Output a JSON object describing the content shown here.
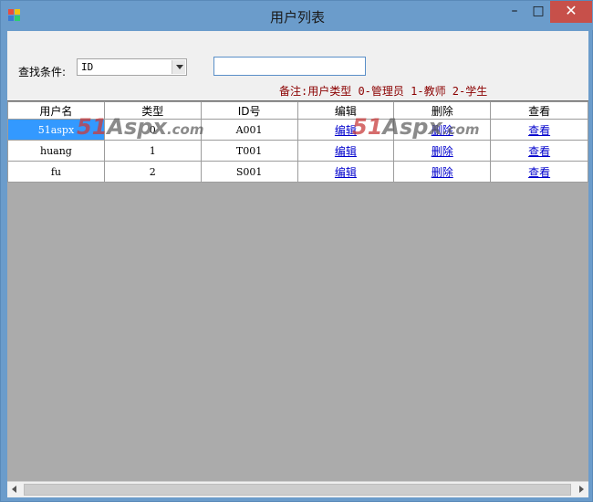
{
  "window": {
    "title": "用户列表",
    "minimize": "–",
    "maximize": "□",
    "close": "✕"
  },
  "search": {
    "label": "查找条件:",
    "field_selected": "ID",
    "text_value": "",
    "note": "备注:用户类型 0-管理员 1-教师 2-学生"
  },
  "grid": {
    "columns": [
      "用户名",
      "类型",
      "ID号",
      "编辑",
      "删除",
      "查看"
    ],
    "rows": [
      {
        "username": "51aspx",
        "type": "0",
        "id": "A001",
        "edit": "编辑",
        "delete": "删除",
        "view": "查看"
      },
      {
        "username": "huang",
        "type": "1",
        "id": "T001",
        "edit": "编辑",
        "delete": "删除",
        "view": "查看"
      },
      {
        "username": "fu",
        "type": "2",
        "id": "S001",
        "edit": "编辑",
        "delete": "删除",
        "view": "查看"
      }
    ]
  },
  "watermark": {
    "num": "51",
    "aspx": "Aspx",
    "com": ".com"
  },
  "colors": {
    "title_bar": "#6b9ccb",
    "selection": "#3399ff",
    "note": "#8b0000",
    "link": "#0000cc",
    "close_button": "#c7504a"
  },
  "icons": [
    "app-icon",
    "minimize-icon",
    "maximize-icon",
    "close-icon",
    "dropdown-arrow-icon",
    "scroll-left-icon",
    "scroll-right-icon"
  ]
}
